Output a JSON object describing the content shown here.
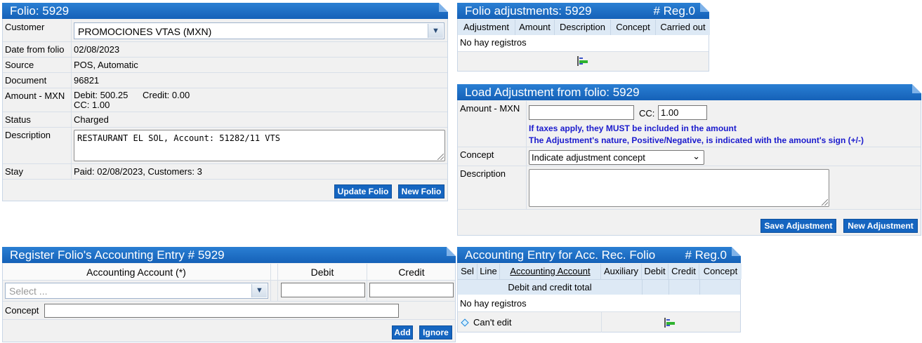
{
  "folio": {
    "title": "Folio: 5929",
    "customer_label": "Customer",
    "customer_value": "PROMOCIONES VTAS (MXN)",
    "date_label": "Date from folio",
    "date_value": "02/08/2023",
    "source_label": "Source",
    "source_value": "POS, Automatic",
    "document_label": "Document",
    "document_value": "96821",
    "amount_label": "Amount - MXN",
    "debit_text": "Debit:  500.25",
    "credit_text": "Credit:  0.00",
    "cc_text": "CC:  1.00",
    "status_label": "Status",
    "status_value": "Charged",
    "description_label": "Description",
    "description_value": "RESTAURANT EL SOL, Account: 51282/11 VTS",
    "stay_label": "Stay",
    "stay_value": "Paid: 02/08/2023, Customers: 3",
    "update_button": "Update Folio",
    "new_button": "New Folio"
  },
  "adjustments": {
    "title": "Folio adjustments: 5929",
    "reg": "# Reg.0",
    "columns": [
      "Adjustment",
      "Amount",
      "Description",
      "Concept",
      "Carried out"
    ],
    "empty_text": "No hay registros",
    "export_icon": "export-icon"
  },
  "load_adjustment": {
    "title": "Load Adjustment from folio: 5929",
    "amount_label": "Amount - MXN",
    "amount_value": "",
    "cc_label": "CC:",
    "cc_value": "1.00",
    "note1": "If taxes apply, they MUST be included in the amount",
    "note2": "The Adjustment's nature, Positive/Negative, is indicated with the amount's sign (+/-)",
    "concept_label": "Concept",
    "concept_value": "Indicate adjustment concept",
    "description_label": "Description",
    "description_value": "",
    "save_button": "Save Adjustment",
    "new_button": "New Adjustment"
  },
  "register": {
    "title": "Register Folio's Accounting Entry # 5929",
    "account_header": "Accounting Account (*)",
    "debit_header": "Debit",
    "credit_header": "Credit",
    "account_placeholder": "Select ...",
    "debit_value": "",
    "credit_value": "",
    "concept_label": "Concept",
    "concept_value": "",
    "add_button": "Add",
    "ignore_button": "Ignore"
  },
  "entry": {
    "title": "Accounting Entry for Acc. Rec. Folio",
    "reg": "# Reg.0",
    "columns": [
      "Sel",
      "Line",
      "Accounting Account",
      "Auxiliary",
      "Debit",
      "Credit",
      "Concept"
    ],
    "total_label": "Debit and credit total",
    "empty_text": "No hay registros",
    "cant_edit": "Can't edit",
    "export_icon": "export-icon"
  },
  "colors": {
    "header": "#1561b8",
    "button": "#1565c0",
    "note": "#1a1acd",
    "panel_bg": "#f1f1f1"
  }
}
